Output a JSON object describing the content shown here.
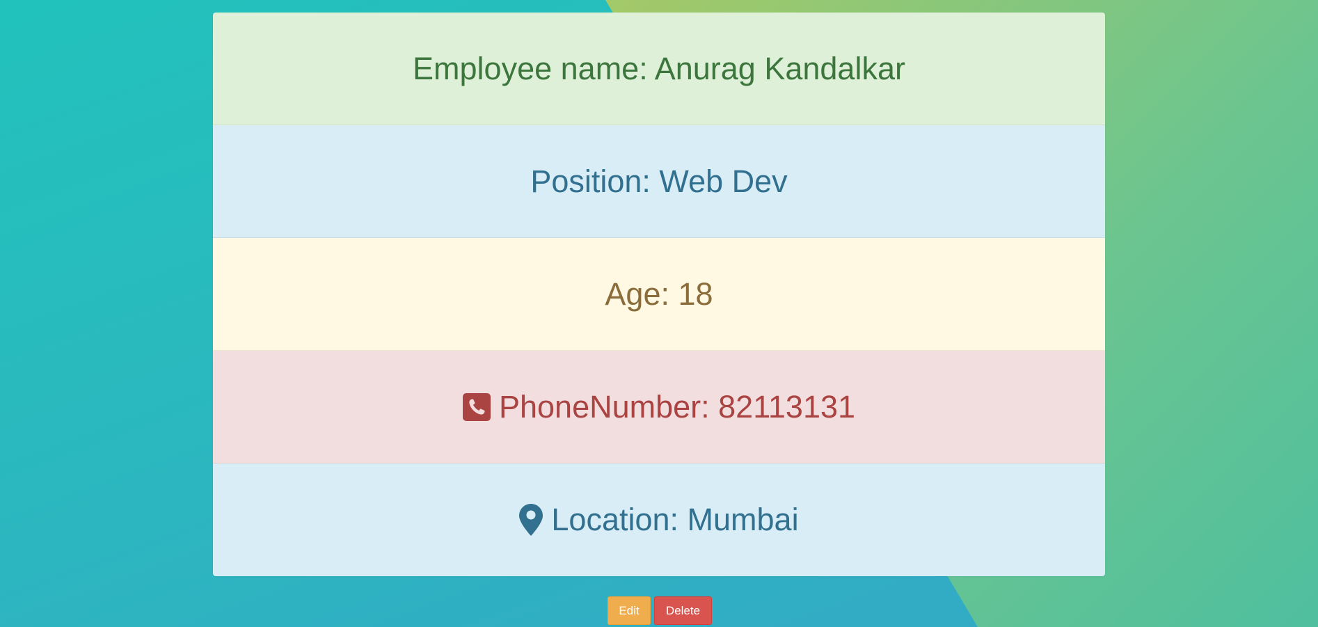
{
  "employee": {
    "name_line": "Employee name: Anurag Kandalkar",
    "position_line": "Position: Web Dev",
    "age_line": "Age: 18",
    "phone_line": "PhoneNumber: 82113131",
    "location_line": "Location: Mumbai"
  },
  "icons": {
    "phone": "phone-square-icon",
    "location": "map-marker-icon"
  },
  "actions": {
    "edit_label": "Edit",
    "delete_label": "Delete"
  },
  "colors": {
    "success_bg": "#dff0d8",
    "info_bg": "#d9edf7",
    "warning_bg": "#fff8e3",
    "danger_bg": "#f2dede",
    "edit_button": "#f0ad4e",
    "delete_button": "#d9534f"
  }
}
